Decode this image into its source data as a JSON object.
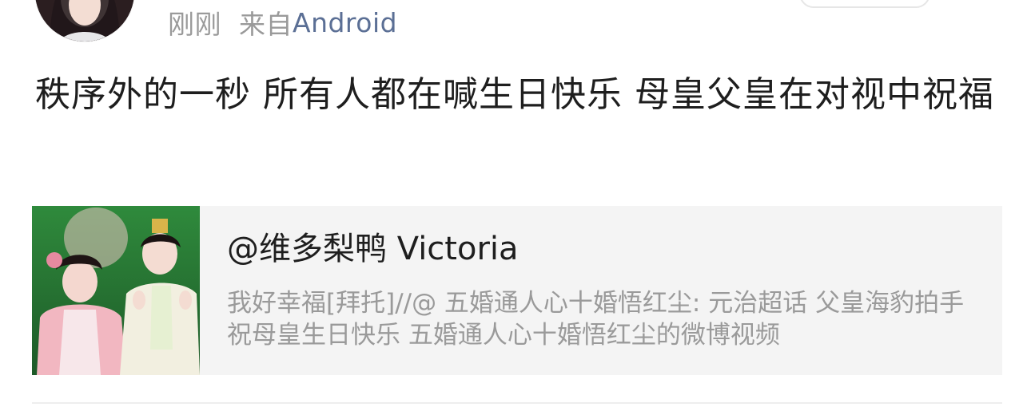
{
  "header": {
    "time": "刚刚",
    "source_prefix": "来自",
    "device": "Android"
  },
  "post": {
    "text": "秩序外的一秒 所有人都在喊生日快乐 母皇父皇在对视中祝福"
  },
  "repost_card": {
    "title": "@维多梨鸭 Victoria",
    "description": "我好幸福[拜托]//@ 五婚通人心十婚悟红尘: 元治超话  父皇海豹拍手祝母皇生日快乐 五婚通人心十婚悟红尘的微博视频"
  },
  "colors": {
    "device_link": "#5b6f95",
    "meta_gray": "#9a9a9a",
    "card_bg": "#f4f4f4",
    "text_dark": "#1e1e1e"
  }
}
